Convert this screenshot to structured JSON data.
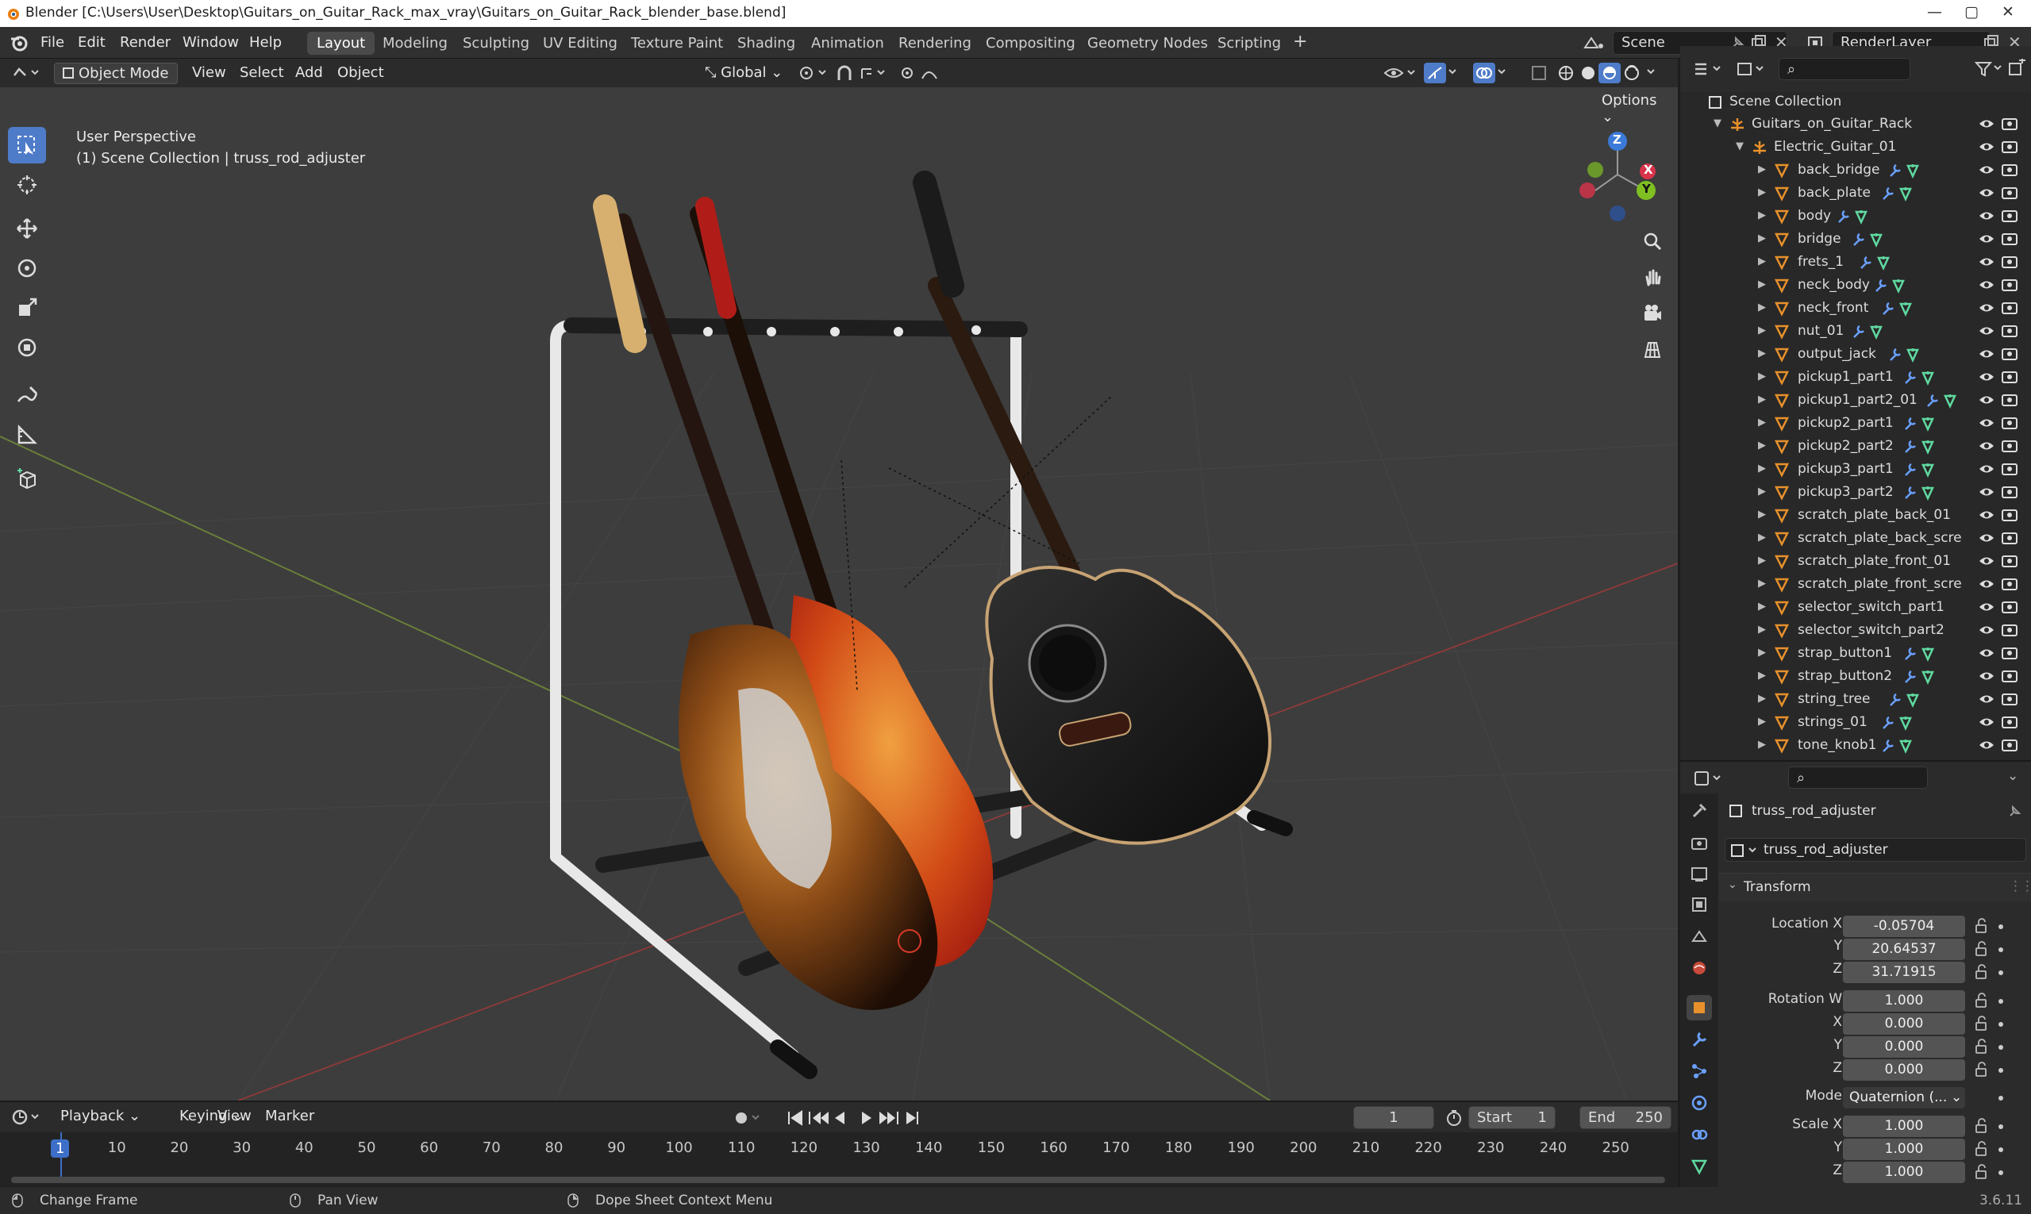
{
  "window": {
    "title": "Blender [C:\\Users\\User\\Desktop\\Guitars_on_Guitar_Rack_max_vray\\Guitars_on_Guitar_Rack_blender_base.blend]",
    "minimize": "—",
    "maximize": "▢",
    "close": "✕"
  },
  "menus": [
    "File",
    "Edit",
    "Render",
    "Window",
    "Help"
  ],
  "workspaces": [
    "Layout",
    "Modeling",
    "Sculpting",
    "UV Editing",
    "Texture Paint",
    "Shading",
    "Animation",
    "Rendering",
    "Compositing",
    "Geometry Nodes",
    "Scripting"
  ],
  "active_workspace": "Layout",
  "add_workspace": "+",
  "scene": {
    "name": "Scene",
    "render_layer": "RenderLayer"
  },
  "viewport_header": {
    "mode": "Object Mode",
    "menus": [
      "View",
      "Select",
      "Add",
      "Object"
    ],
    "orientation": "Global",
    "options": "Options"
  },
  "viewport": {
    "perspective": "User Perspective",
    "collection_info": "(1) Scene Collection | truss_rod_adjuster",
    "gizmo_z": "Z",
    "gizmo_y": "Y",
    "gizmo_x": "X"
  },
  "outliner": {
    "root": "Scene Collection",
    "collection": "Guitars_on_Guitar_Rack",
    "child": "Electric_Guitar_01",
    "items": [
      {
        "name": "back_bridge",
        "mod": true
      },
      {
        "name": "back_plate",
        "mod": true
      },
      {
        "name": "body",
        "mod": true
      },
      {
        "name": "bridge",
        "mod": true
      },
      {
        "name": "frets_1",
        "mod": true
      },
      {
        "name": "neck_body",
        "mod": true
      },
      {
        "name": "neck_front",
        "mod": true
      },
      {
        "name": "nut_01",
        "mod": true
      },
      {
        "name": "output_jack",
        "mod": true
      },
      {
        "name": "pickup1_part1",
        "mod": true
      },
      {
        "name": "pickup1_part2_01",
        "mod": true
      },
      {
        "name": "pickup2_part1",
        "mod": true
      },
      {
        "name": "pickup2_part2",
        "mod": true
      },
      {
        "name": "pickup3_part1",
        "mod": true
      },
      {
        "name": "pickup3_part2",
        "mod": true
      },
      {
        "name": "scratch_plate_back_01",
        "mod": false
      },
      {
        "name": "scratch_plate_back_scre",
        "mod": false
      },
      {
        "name": "scratch_plate_front_01",
        "mod": false
      },
      {
        "name": "scratch_plate_front_scre",
        "mod": false
      },
      {
        "name": "selector_switch_part1",
        "mod": false
      },
      {
        "name": "selector_switch_part2",
        "mod": false
      },
      {
        "name": "strap_button1",
        "mod": true
      },
      {
        "name": "strap_button2",
        "mod": true
      },
      {
        "name": "string_tree",
        "mod": true
      },
      {
        "name": "strings_01",
        "mod": true
      },
      {
        "name": "tone_knob1",
        "mod": true
      }
    ]
  },
  "properties": {
    "object_name": "truss_rod_adjuster",
    "data_name": "truss_rod_adjuster",
    "panel": "Transform",
    "location": {
      "label": "Location X",
      "x": "-0.05704",
      "y": "20.64537",
      "z": "31.71915"
    },
    "rotation": {
      "label": "Rotation W",
      "w": "1.000",
      "x": "0.000",
      "y": "0.000",
      "z": "0.000"
    },
    "mode_label": "Mode",
    "mode_value": "Quaternion (...",
    "scale": {
      "label": "Scale X",
      "x": "1.000",
      "y": "1.000",
      "z": "1.000"
    },
    "axis_labels": {
      "x": "X",
      "y": "Y",
      "z": "Z"
    }
  },
  "timeline": {
    "menus": [
      "Playback",
      "Keying",
      "View",
      "Marker"
    ],
    "current_frame": "1",
    "start_label": "Start",
    "start": "1",
    "end_label": "End",
    "end": "250",
    "ticks": [
      "1",
      "10",
      "20",
      "30",
      "40",
      "50",
      "60",
      "70",
      "80",
      "90",
      "100",
      "110",
      "120",
      "130",
      "140",
      "150",
      "160",
      "170",
      "180",
      "190",
      "200",
      "210",
      "220",
      "230",
      "240",
      "250"
    ]
  },
  "status": {
    "left": "Change Frame",
    "middle": "Pan View",
    "right": "Dope Sheet Context Menu",
    "version": "3.6.11"
  },
  "colors": {
    "accent": "#4f7cc9",
    "active_frame": "#3d6fc9",
    "object_orange": "#e8912b",
    "modifier_blue": "#6aa0ff",
    "mesh_green": "#5fd9a0"
  }
}
